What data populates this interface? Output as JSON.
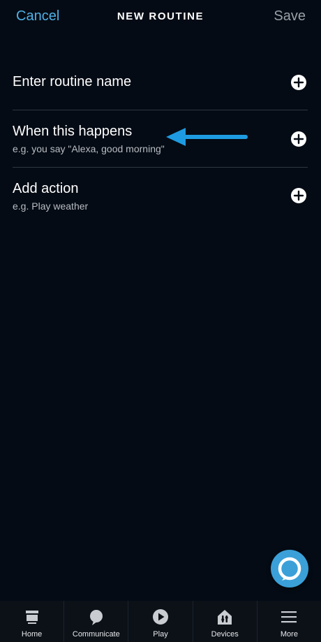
{
  "header": {
    "cancel_label": "Cancel",
    "title": "NEW ROUTINE",
    "save_label": "Save"
  },
  "rows": [
    {
      "title": "Enter routine name",
      "subtitle": ""
    },
    {
      "title": "When this happens",
      "subtitle": "e.g. you say \"Alexa, good morning\""
    },
    {
      "title": "Add action",
      "subtitle": "e.g. Play weather"
    }
  ],
  "annotation": {
    "arrow_color": "#1e9be0",
    "arrow_icon": "arrow-left-icon"
  },
  "fab": {
    "icon": "alexa-icon",
    "color": "#3ba0d8"
  },
  "tabs": [
    {
      "label": "Home",
      "icon": "home-icon"
    },
    {
      "label": "Communicate",
      "icon": "speech-bubble-icon"
    },
    {
      "label": "Play",
      "icon": "play-icon"
    },
    {
      "label": "Devices",
      "icon": "devices-icon"
    },
    {
      "label": "More",
      "icon": "menu-icon"
    }
  ],
  "colors": {
    "background": "#050b14",
    "accent": "#4fb0e6",
    "save_disabled": "#9aa0a6",
    "tabbar": "#0c1118"
  }
}
